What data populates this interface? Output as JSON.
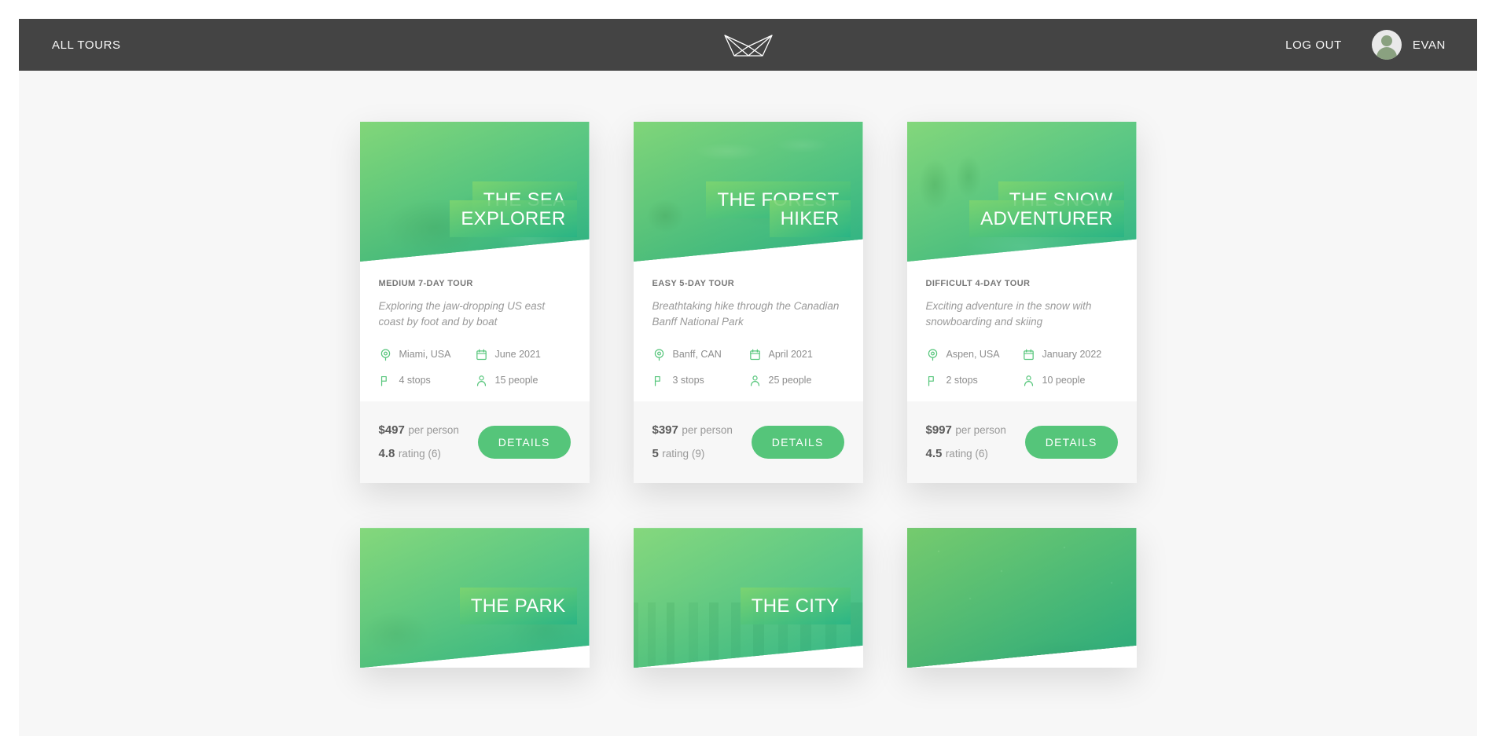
{
  "header": {
    "nav_left_label": "ALL TOURS",
    "logo_name": "natours-logo",
    "logout_label": "LOG OUT",
    "user_name": "EVAN",
    "bg_color": "#444444",
    "text_color": "#f7f7f7"
  },
  "theme": {
    "accent_green": "#55c57a",
    "gradient_light": "#7ed56f",
    "gradient_dark": "#28b485",
    "page_bg": "#f7f7f7",
    "card_bg": "#ffffff",
    "muted_text": "#999999"
  },
  "icons": {
    "location": "map-pin-icon",
    "date": "calendar-icon",
    "stops": "flag-icon",
    "people": "person-icon"
  },
  "fact_labels": {
    "location": "location",
    "date": "date",
    "stops": "stops",
    "people": "people"
  },
  "cards": [
    {
      "id": "sea-explorer",
      "photo": "photo-sea",
      "title_lines": [
        "THE SEA",
        "EXPLORER"
      ],
      "subtitle": "MEDIUM 7-DAY TOUR",
      "description": "Exploring the jaw-dropping US east coast by foot and by boat",
      "facts": {
        "location": "Miami, USA",
        "date": "June 2021",
        "stops": "4 stops",
        "people": "15 people"
      },
      "price_value": "$497",
      "price_label": "per person",
      "rating_value": "4.8",
      "rating_label": "rating (6)",
      "cta_label": "DETAILS"
    },
    {
      "id": "forest-hiker",
      "photo": "photo-forest",
      "title_lines": [
        "THE FOREST",
        "HIKER"
      ],
      "subtitle": "EASY 5-DAY TOUR",
      "description": "Breathtaking hike through the Canadian Banff National Park",
      "facts": {
        "location": "Banff, CAN",
        "date": "April 2021",
        "stops": "3 stops",
        "people": "25 people"
      },
      "price_value": "$397",
      "price_label": "per person",
      "rating_value": "5",
      "rating_label": "rating (9)",
      "cta_label": "DETAILS"
    },
    {
      "id": "snow-adventurer",
      "photo": "photo-snow",
      "title_lines": [
        "THE SNOW",
        "ADVENTURER"
      ],
      "subtitle": "DIFFICULT 4-DAY TOUR",
      "description": "Exciting adventure in the snow with snowboarding and skiing",
      "facts": {
        "location": "Aspen, USA",
        "date": "January 2022",
        "stops": "2 stops",
        "people": "10 people"
      },
      "price_value": "$997",
      "price_label": "per person",
      "rating_value": "4.5",
      "rating_label": "rating (6)",
      "cta_label": "DETAILS"
    },
    {
      "id": "park-camper",
      "photo": "photo-park",
      "title_lines": [
        "THE PARK",
        ""
      ],
      "subtitle": "",
      "description": "",
      "facts": {
        "location": "",
        "date": "",
        "stops": "",
        "people": ""
      },
      "price_value": "",
      "price_label": "",
      "rating_value": "",
      "rating_label": "",
      "cta_label": ""
    },
    {
      "id": "city-wanderer",
      "photo": "photo-city",
      "title_lines": [
        "THE CITY",
        ""
      ],
      "subtitle": "",
      "description": "",
      "facts": {
        "location": "",
        "date": "",
        "stops": "",
        "people": ""
      },
      "price_value": "",
      "price_label": "",
      "rating_value": "",
      "rating_label": "",
      "cta_label": ""
    },
    {
      "id": "star-gazer",
      "photo": "photo-night",
      "title_lines": [
        "",
        ""
      ],
      "subtitle": "",
      "description": "",
      "facts": {
        "location": "",
        "date": "",
        "stops": "",
        "people": ""
      },
      "price_value": "",
      "price_label": "",
      "rating_value": "",
      "rating_label": "",
      "cta_label": ""
    }
  ]
}
